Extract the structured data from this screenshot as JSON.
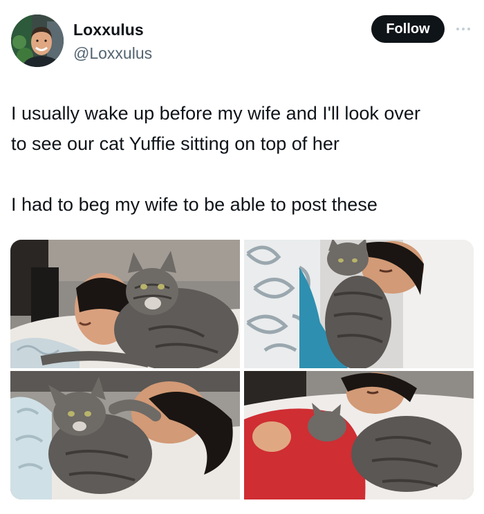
{
  "author": {
    "display_name": "Loxxulus",
    "handle": "@Loxxulus",
    "avatar_icon": "profile-avatar"
  },
  "actions": {
    "follow_label": "Follow",
    "more_icon": "more-options-icon"
  },
  "tweet": {
    "paragraphs": [
      "I usually wake up before my wife and I'll look over\nto see our cat Yuffie sitting on top of her",
      "I had to beg my wife to be able to post these"
    ]
  },
  "media": {
    "photo_count": 4,
    "photos": [
      {
        "subject": "tabby cat on sleeping woman, top-left"
      },
      {
        "subject": "tabby cat on sleeping woman, top-right"
      },
      {
        "subject": "tabby cat on sleeping woman, bottom-left"
      },
      {
        "subject": "tabby cat on sleeping woman, bottom-right"
      }
    ]
  },
  "colors": {
    "text_primary": "#0f1419",
    "text_secondary": "#536471",
    "follow_bg": "#0f1419",
    "follow_text": "#ffffff",
    "background": "#ffffff"
  }
}
